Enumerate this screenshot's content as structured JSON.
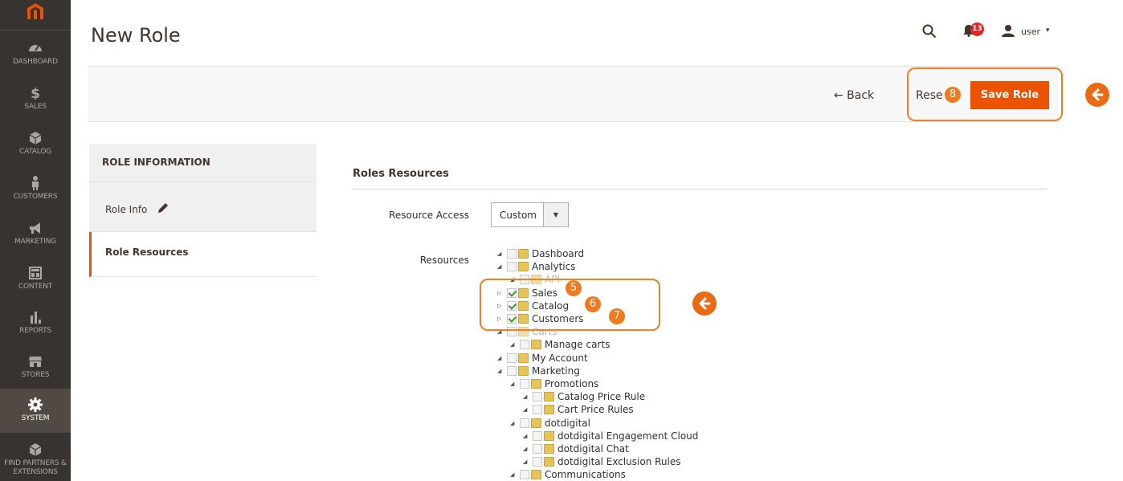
{
  "sidebar": {
    "items": [
      {
        "label": "DASHBOARD",
        "icon": "dashboard-icon"
      },
      {
        "label": "SALES",
        "icon": "dollar-icon"
      },
      {
        "label": "CATALOG",
        "icon": "box-icon"
      },
      {
        "label": "CUSTOMERS",
        "icon": "person-icon"
      },
      {
        "label": "MARKETING",
        "icon": "megaphone-icon"
      },
      {
        "label": "CONTENT",
        "icon": "layout-icon"
      },
      {
        "label": "REPORTS",
        "icon": "bar-chart-icon"
      },
      {
        "label": "STORES",
        "icon": "store-icon"
      },
      {
        "label": "SYSTEM",
        "icon": "gear-icon"
      },
      {
        "label": "FIND PARTNERS & EXTENSIONS",
        "icon": "cube-icon"
      }
    ],
    "active": "SYSTEM"
  },
  "header": {
    "title": "New Role",
    "notification_count": "13",
    "user": "user",
    "caret": "▾"
  },
  "actions": {
    "back": "← Back",
    "reset": "Rese",
    "save": "Save Role"
  },
  "markers": {
    "m5": "5",
    "m6": "6",
    "m7": "7",
    "m8": "8"
  },
  "tabs": {
    "title": "ROLE INFORMATION",
    "items": [
      "Role Info",
      "Role Resources"
    ]
  },
  "main": {
    "section_title": "Roles Resources",
    "resource_access_label": "Resource Access",
    "resource_access_value": "Custom",
    "select_caret": "▼",
    "resources_label": "Resources"
  },
  "tree": [
    {
      "label": "Dashboard",
      "level": 0,
      "checked": false,
      "toggle": "◢"
    },
    {
      "label": "Analytics",
      "level": 0,
      "checked": false,
      "toggle": "◢"
    },
    {
      "label": "API",
      "level": 1,
      "checked": false,
      "toggle": "◢",
      "faded": true
    },
    {
      "label": "Sales",
      "level": 0,
      "checked": true,
      "toggle": "▷"
    },
    {
      "label": "Catalog",
      "level": 0,
      "checked": true,
      "toggle": "▷"
    },
    {
      "label": "Customers",
      "level": 0,
      "checked": true,
      "toggle": "▷"
    },
    {
      "label": "Carts",
      "level": 0,
      "checked": false,
      "toggle": "◢",
      "faded": true
    },
    {
      "label": "Manage carts",
      "level": 1,
      "checked": false,
      "toggle": "◢"
    },
    {
      "label": "My Account",
      "level": 0,
      "checked": false,
      "toggle": "◢"
    },
    {
      "label": "Marketing",
      "level": 0,
      "checked": false,
      "toggle": "◢"
    },
    {
      "label": "Promotions",
      "level": 1,
      "checked": false,
      "toggle": "◢"
    },
    {
      "label": "Catalog Price Rule",
      "level": 2,
      "checked": false,
      "toggle": "◢"
    },
    {
      "label": "Cart Price Rules",
      "level": 2,
      "checked": false,
      "toggle": "◢"
    },
    {
      "label": "dotdigital",
      "level": 1,
      "checked": false,
      "toggle": "◢"
    },
    {
      "label": "dotdigital Engagement Cloud",
      "level": 2,
      "checked": false,
      "toggle": "◢"
    },
    {
      "label": "dotdigital Chat",
      "level": 2,
      "checked": false,
      "toggle": "◢"
    },
    {
      "label": "dotdigital Exclusion Rules",
      "level": 2,
      "checked": false,
      "toggle": "◢"
    },
    {
      "label": "Communications",
      "level": 1,
      "checked": false,
      "toggle": "◢"
    }
  ],
  "colors": {
    "accent": "#eb5202",
    "highlight": "#f57d22",
    "sidebar": "#373330"
  }
}
